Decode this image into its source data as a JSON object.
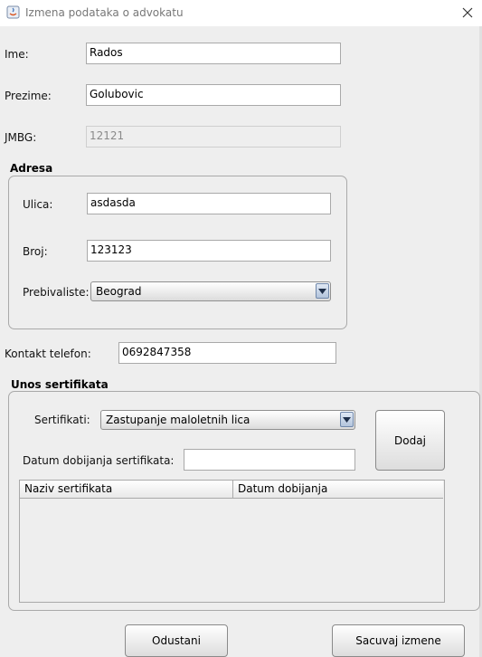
{
  "window": {
    "title": "Izmena podataka o advokatu"
  },
  "form": {
    "ime_label": "Ime:",
    "ime_value": "Rados",
    "prezime_label": "Prezime:",
    "prezime_value": "Golubovic",
    "jmbg_label": "JMBG:",
    "jmbg_value": "12121",
    "adresa": {
      "title": "Adresa",
      "ulica_label": "Ulica:",
      "ulica_value": "asdasda",
      "broj_label": "Broj:",
      "broj_value": "123123",
      "prebivaliste_label": "Prebivaliste:",
      "prebivaliste_value": "Beograd"
    },
    "kontakt_label": "Kontakt telefon:",
    "kontakt_value": "0692847358",
    "sertifikati": {
      "title": "Unos sertifikata",
      "label": "Sertifikati:",
      "selected": "Zastupanje maloletnih lica",
      "add_button": "Dodaj",
      "datum_label": "Datum dobijanja sertifikata:",
      "datum_value": "",
      "table": {
        "columns": [
          "Naziv sertifikata",
          "Datum dobijanja"
        ],
        "rows": []
      }
    }
  },
  "buttons": {
    "cancel": "Odustani",
    "save": "Sacuvaj izmene"
  },
  "colors": {
    "background": "#eeeeee",
    "field_border": "#a9a9a9",
    "combo_arrow": "#b2c4dc"
  }
}
